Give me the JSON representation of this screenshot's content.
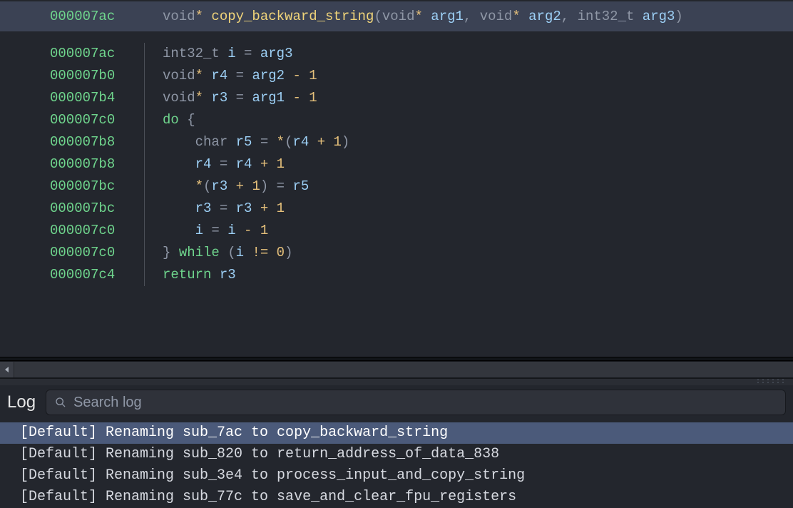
{
  "function": {
    "signature_addr": "000007ac",
    "return_type": "void*",
    "name": "copy_backward_string",
    "params": [
      {
        "type": "void*",
        "name": "arg1"
      },
      {
        "type": "void*",
        "name": "arg2"
      },
      {
        "type": "int32_t",
        "name": "arg3"
      }
    ]
  },
  "lines": [
    {
      "addr": "000007ac",
      "indent": 0,
      "tokens": [
        [
          "type",
          "int32_t"
        ],
        [
          "txt",
          " "
        ],
        [
          "var",
          "i"
        ],
        [
          "txt",
          " "
        ],
        [
          "pun",
          "="
        ],
        [
          "txt",
          " "
        ],
        [
          "arg",
          "arg3"
        ]
      ]
    },
    {
      "addr": "000007b0",
      "indent": 0,
      "tokens": [
        [
          "type",
          "void"
        ],
        [
          "star",
          "*"
        ],
        [
          "txt",
          " "
        ],
        [
          "var",
          "r4"
        ],
        [
          "txt",
          " "
        ],
        [
          "pun",
          "="
        ],
        [
          "txt",
          " "
        ],
        [
          "arg",
          "arg2"
        ],
        [
          "txt",
          " "
        ],
        [
          "op",
          "-"
        ],
        [
          "txt",
          " "
        ],
        [
          "num",
          "1"
        ]
      ]
    },
    {
      "addr": "000007b4",
      "indent": 0,
      "tokens": [
        [
          "type",
          "void"
        ],
        [
          "star",
          "*"
        ],
        [
          "txt",
          " "
        ],
        [
          "var",
          "r3"
        ],
        [
          "txt",
          " "
        ],
        [
          "pun",
          "="
        ],
        [
          "txt",
          " "
        ],
        [
          "arg",
          "arg1"
        ],
        [
          "txt",
          " "
        ],
        [
          "op",
          "-"
        ],
        [
          "txt",
          " "
        ],
        [
          "num",
          "1"
        ]
      ]
    },
    {
      "addr": "000007c0",
      "indent": 0,
      "tokens": [
        [
          "kw",
          "do"
        ],
        [
          "txt",
          " "
        ],
        [
          "pun",
          "{"
        ]
      ]
    },
    {
      "addr": "000007b8",
      "indent": 1,
      "tokens": [
        [
          "type",
          "char"
        ],
        [
          "txt",
          " "
        ],
        [
          "var",
          "r5"
        ],
        [
          "txt",
          " "
        ],
        [
          "pun",
          "="
        ],
        [
          "txt",
          " "
        ],
        [
          "star",
          "*"
        ],
        [
          "pun",
          "("
        ],
        [
          "var",
          "r4"
        ],
        [
          "txt",
          " "
        ],
        [
          "op",
          "+"
        ],
        [
          "txt",
          " "
        ],
        [
          "num",
          "1"
        ],
        [
          "pun",
          ")"
        ]
      ]
    },
    {
      "addr": "000007b8",
      "indent": 1,
      "tokens": [
        [
          "var",
          "r4"
        ],
        [
          "txt",
          " "
        ],
        [
          "pun",
          "="
        ],
        [
          "txt",
          " "
        ],
        [
          "var",
          "r4"
        ],
        [
          "txt",
          " "
        ],
        [
          "op",
          "+"
        ],
        [
          "txt",
          " "
        ],
        [
          "num",
          "1"
        ]
      ]
    },
    {
      "addr": "000007bc",
      "indent": 1,
      "tokens": [
        [
          "star",
          "*"
        ],
        [
          "pun",
          "("
        ],
        [
          "var",
          "r3"
        ],
        [
          "txt",
          " "
        ],
        [
          "op",
          "+"
        ],
        [
          "txt",
          " "
        ],
        [
          "num",
          "1"
        ],
        [
          "pun",
          ")"
        ],
        [
          "txt",
          " "
        ],
        [
          "pun",
          "="
        ],
        [
          "txt",
          " "
        ],
        [
          "var",
          "r5"
        ]
      ]
    },
    {
      "addr": "000007bc",
      "indent": 1,
      "tokens": [
        [
          "var",
          "r3"
        ],
        [
          "txt",
          " "
        ],
        [
          "pun",
          "="
        ],
        [
          "txt",
          " "
        ],
        [
          "var",
          "r3"
        ],
        [
          "txt",
          " "
        ],
        [
          "op",
          "+"
        ],
        [
          "txt",
          " "
        ],
        [
          "num",
          "1"
        ]
      ]
    },
    {
      "addr": "000007c0",
      "indent": 1,
      "tokens": [
        [
          "var",
          "i"
        ],
        [
          "txt",
          " "
        ],
        [
          "pun",
          "="
        ],
        [
          "txt",
          " "
        ],
        [
          "var",
          "i"
        ],
        [
          "txt",
          " "
        ],
        [
          "op",
          "-"
        ],
        [
          "txt",
          " "
        ],
        [
          "num",
          "1"
        ]
      ]
    },
    {
      "addr": "000007c0",
      "indent": 0,
      "tokens": [
        [
          "pun",
          "}"
        ],
        [
          "txt",
          " "
        ],
        [
          "kw",
          "while"
        ],
        [
          "txt",
          " "
        ],
        [
          "pun",
          "("
        ],
        [
          "var",
          "i"
        ],
        [
          "txt",
          " "
        ],
        [
          "op",
          "!="
        ],
        [
          "txt",
          " "
        ],
        [
          "num",
          "0"
        ],
        [
          "pun",
          ")"
        ]
      ]
    },
    {
      "addr": "000007c4",
      "indent": 0,
      "tokens": [
        [
          "kw",
          "return"
        ],
        [
          "txt",
          " "
        ],
        [
          "var",
          "r3"
        ]
      ]
    }
  ],
  "log": {
    "title": "Log",
    "search_placeholder": "Search log",
    "entries": [
      {
        "selected": true,
        "text": "[Default] Renaming sub_7ac to copy_backward_string"
      },
      {
        "selected": false,
        "text": "[Default] Renaming sub_820 to return_address_of_data_838"
      },
      {
        "selected": false,
        "text": "[Default] Renaming sub_3e4 to process_input_and_copy_string"
      },
      {
        "selected": false,
        "text": "[Default] Renaming sub_77c to save_and_clear_fpu_registers"
      }
    ]
  }
}
